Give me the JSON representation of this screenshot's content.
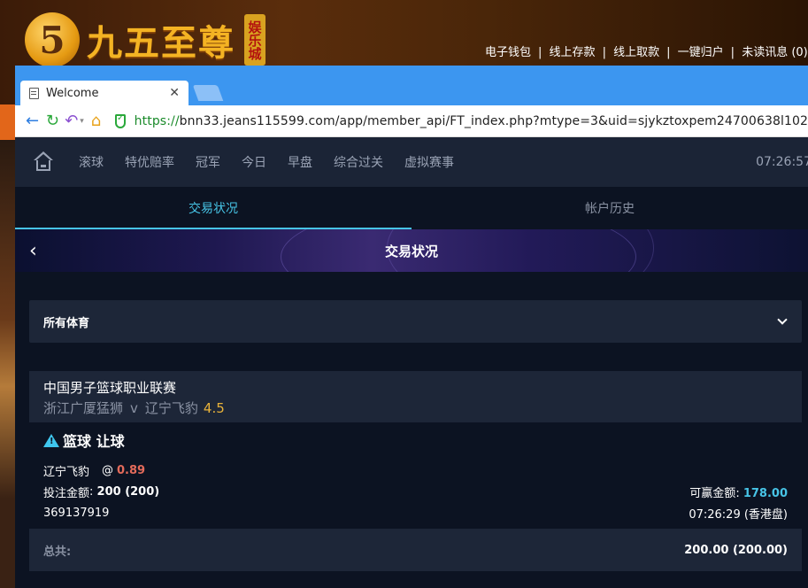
{
  "background_site": {
    "logo_numeral": "5",
    "logo_text": "九五至尊",
    "logo_badge": "娱乐城",
    "links": [
      "电子钱包",
      "线上存款",
      "线上取款",
      "一键归户",
      "未读讯息 (0)"
    ]
  },
  "browser": {
    "tab_title": "Welcome",
    "tab_close": "✕",
    "url_protocol": "https://",
    "url_rest": "bnn33.jeans115599.com/app/member_api/FT_index.php?mtype=3&uid=sjykztoxpem24700638l102"
  },
  "topnav": {
    "items": [
      "滚球",
      "特优赔率",
      "冠军",
      "今日",
      "早盘",
      "综合过关",
      "虚拟赛事"
    ],
    "time": "07:26:57"
  },
  "subtabs": [
    "交易状况",
    "帐户历史"
  ],
  "banner": {
    "back": "‹",
    "title": "交易状况"
  },
  "filter": {
    "label": "所有体育"
  },
  "bet": {
    "league": "中国男子篮球职业联赛",
    "home": "浙江广厦猛狮",
    "vs": "v",
    "away": "辽宁飞豹",
    "line": "4.5",
    "type": "篮球 让球",
    "selection": "辽宁飞豹",
    "at": "@",
    "odds": "0.89",
    "stake_label": "投注金额",
    "stake_value": "200 (200)",
    "win_label": "可赢金额",
    "win_value": "178.00",
    "ticket": "369137919",
    "time": "07:26:29 (香港盘)"
  },
  "total": {
    "label": "总共:",
    "value": "200.00 (200.00)"
  }
}
